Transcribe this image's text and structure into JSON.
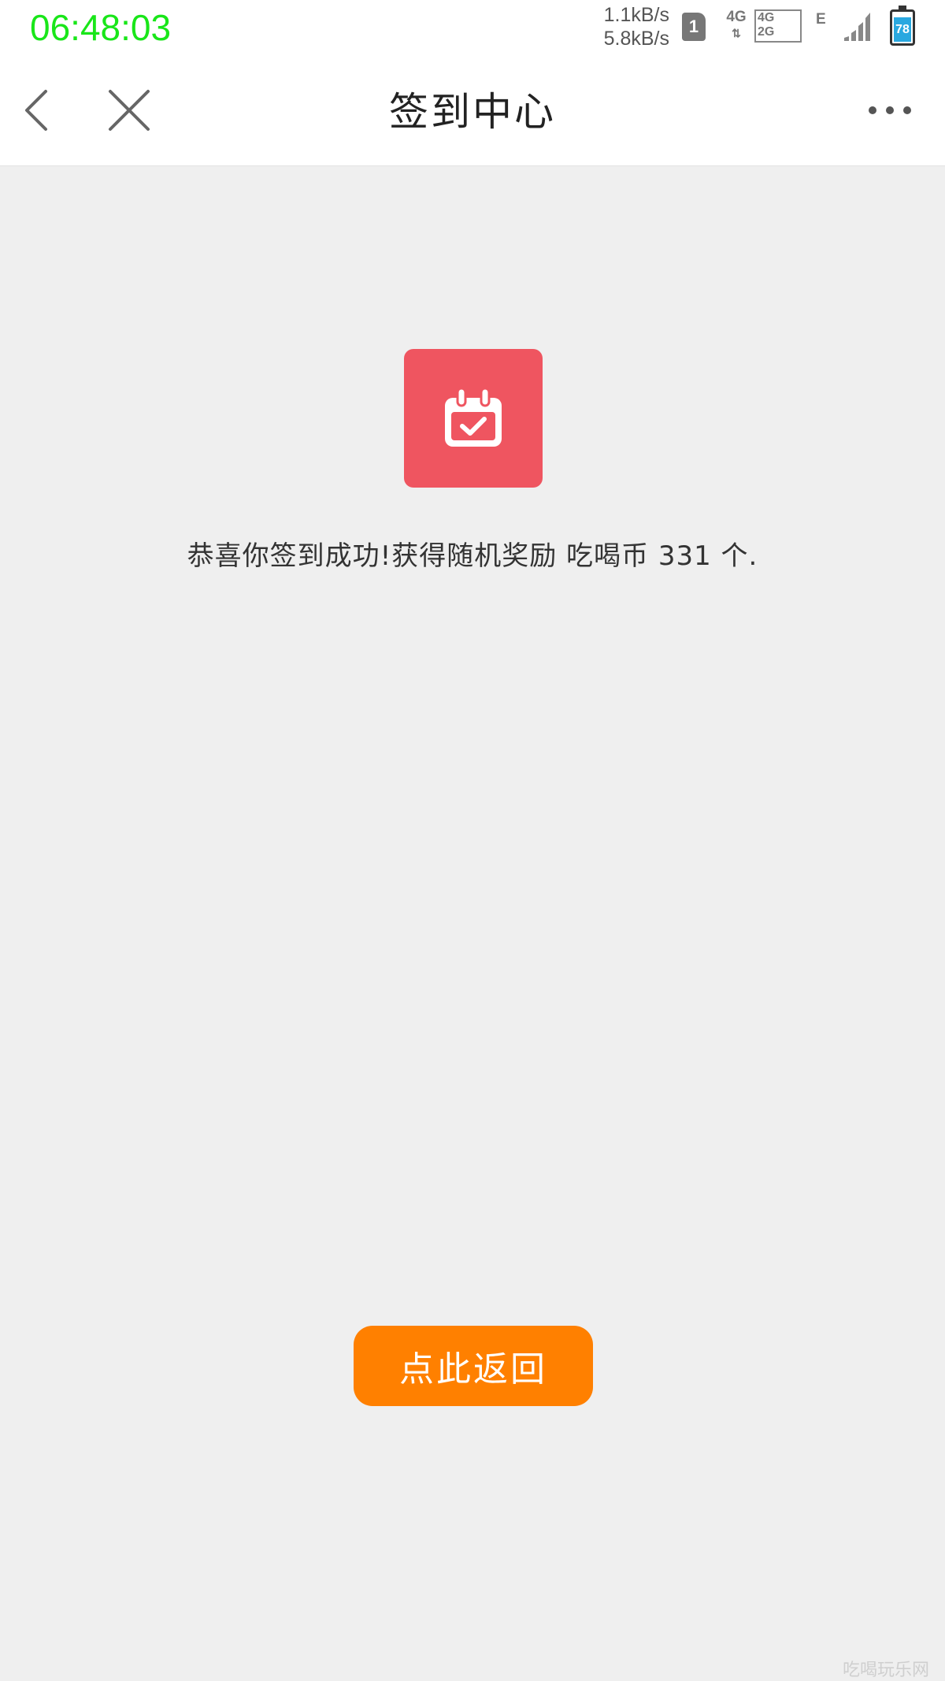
{
  "status_bar": {
    "time": "06:48:03",
    "upload_speed": "1.1kB/s",
    "download_speed": "5.8kB/s",
    "sim_slot": "1",
    "network_4g": "4G",
    "network_4g_label": "4G",
    "network_2g_label": "2G",
    "network_e": "E",
    "battery_level": "78"
  },
  "nav": {
    "title": "签到中心",
    "back_icon": "chevron-left-icon",
    "close_icon": "close-icon",
    "more_icon": "more-dots-icon"
  },
  "main": {
    "icon": "calendar-check-icon",
    "icon_color": "#ef5560",
    "message": "恭喜你签到成功!获得随机奖励 吃喝币 331 个.",
    "return_button_label": "点此返回",
    "return_button_color": "#ff8000"
  },
  "watermark": "吃喝玩乐网"
}
